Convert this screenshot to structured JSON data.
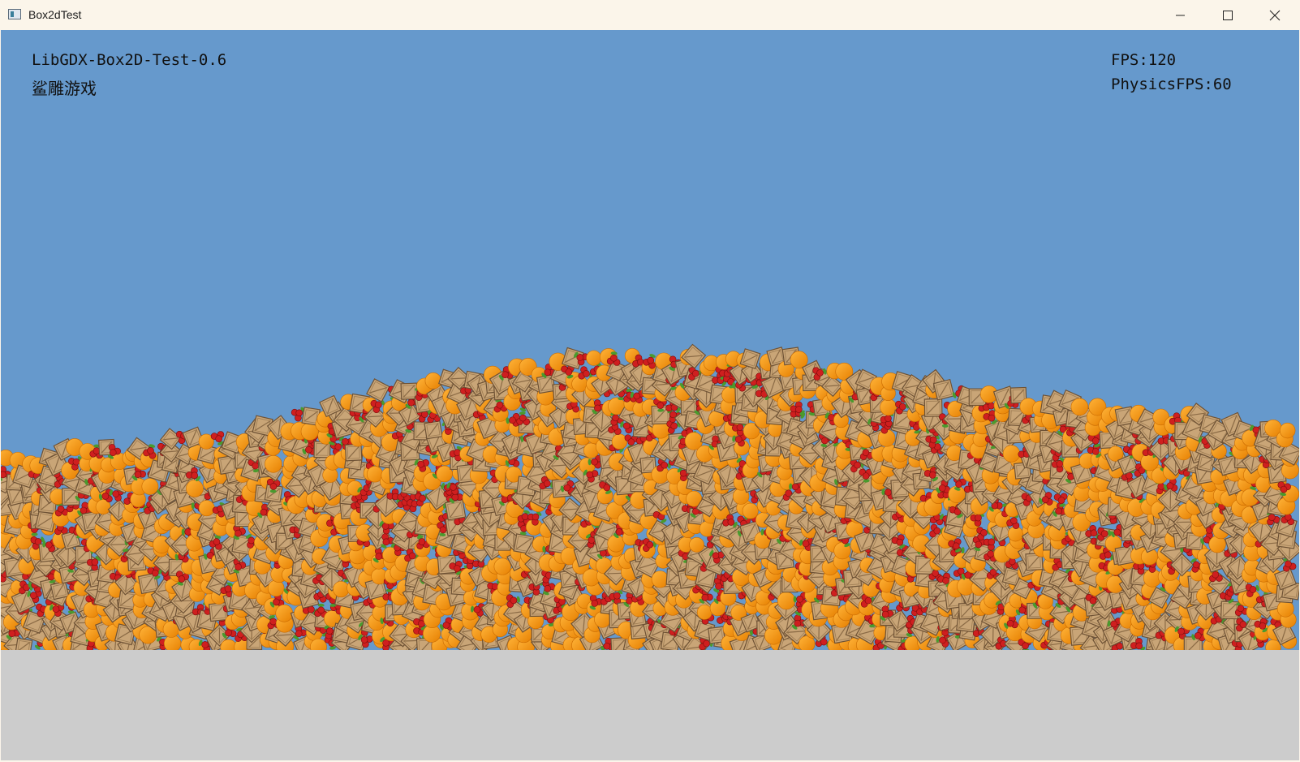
{
  "window": {
    "title": "Box2dTest",
    "icons": {
      "app": "app-window-icon",
      "minimize": "minimize-icon",
      "maximize": "maximize-icon",
      "close": "close-icon"
    }
  },
  "hud": {
    "title": "LibGDX-Box2D-Test-0.6",
    "subtitle": "鲨雕游戏",
    "fps": "FPS:120",
    "physics_fps": "PhysicsFPS:60"
  },
  "scene": {
    "sky_color": "#6699cc",
    "ground_color": "#cccccc",
    "object_types": [
      "crate",
      "orange",
      "cherry"
    ],
    "object_colors": {
      "crate": "#c9a577",
      "orange": "#f8980f",
      "cherry": "#cf1f1f",
      "leaf": "#4a9a2e"
    }
  }
}
